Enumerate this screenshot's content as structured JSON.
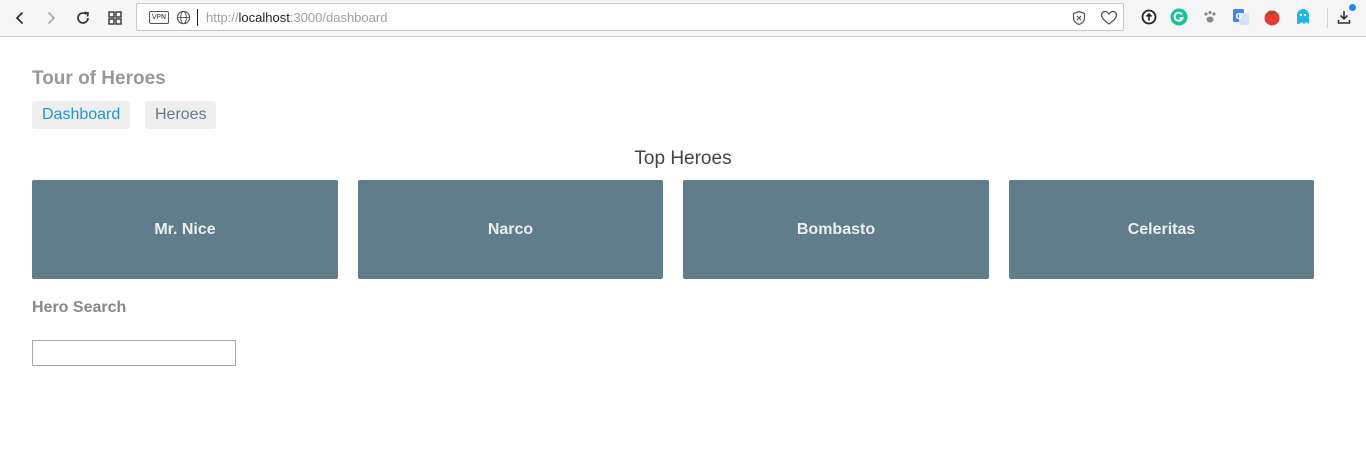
{
  "browser": {
    "url_scheme": "http://",
    "url_host": "localhost",
    "url_path": ":3000/dashboard",
    "vpn_label": "VPN"
  },
  "app": {
    "title": "Tour of Heroes",
    "nav": [
      {
        "label": "Dashboard",
        "active": true
      },
      {
        "label": "Heroes",
        "active": false
      }
    ]
  },
  "dashboard": {
    "heading": "Top Heroes",
    "heroes": [
      "Mr. Nice",
      "Narco",
      "Bombasto",
      "Celeritas"
    ]
  },
  "search": {
    "heading": "Hero Search",
    "value": ""
  },
  "colors": {
    "hero_card_bg": "#607d8b",
    "active_link": "#1a99d6"
  }
}
